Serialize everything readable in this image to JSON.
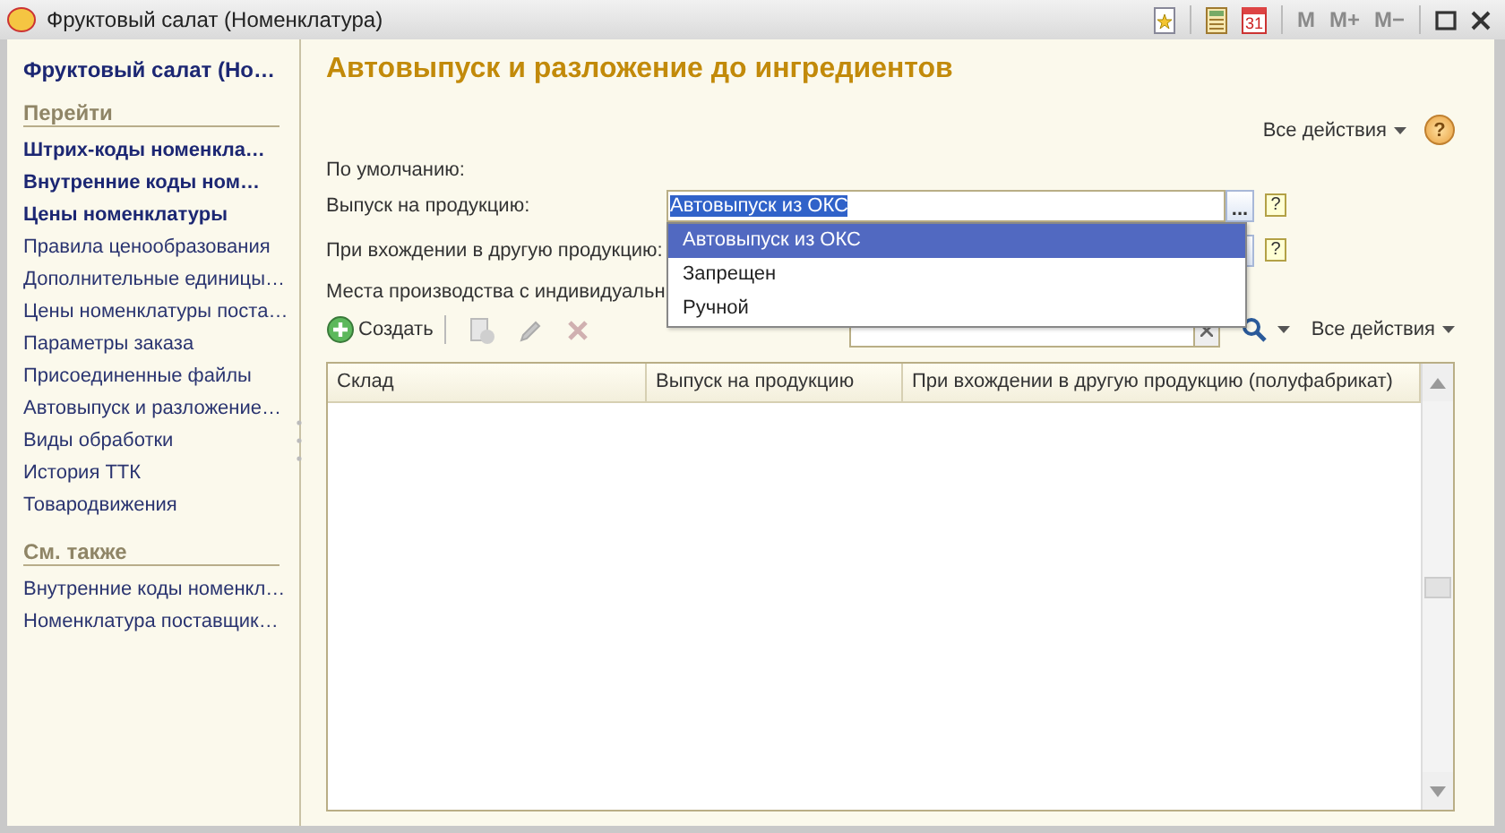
{
  "window": {
    "title": "Фруктовый салат (Номенклатура)",
    "calendar_day": "31",
    "memory_buttons": [
      {
        "label": "M",
        "disabled": true
      },
      {
        "label": "M+",
        "disabled": true
      },
      {
        "label": "M−",
        "disabled": true
      }
    ]
  },
  "sidebar": {
    "title": "Фруктовый салат (Но…",
    "sections": [
      {
        "heading": "Перейти",
        "items": [
          {
            "label": "Штрих-коды номенкла…",
            "bold": true
          },
          {
            "label": "Внутренние коды ном…",
            "bold": true
          },
          {
            "label": "Цены номенклатуры",
            "bold": true
          },
          {
            "label": "Правила ценообразования",
            "bold": false
          },
          {
            "label": "Дополнительные единицы…",
            "bold": false
          },
          {
            "label": "Цены номенклатуры поста…",
            "bold": false
          },
          {
            "label": "Параметры заказа",
            "bold": false
          },
          {
            "label": "Присоединенные файлы",
            "bold": false
          },
          {
            "label": "Автовыпуск и разложение…",
            "bold": false
          },
          {
            "label": "Виды обработки",
            "bold": false
          },
          {
            "label": "История ТТК",
            "bold": false
          },
          {
            "label": "Товародвижения",
            "bold": false
          }
        ]
      },
      {
        "heading": "См. также",
        "items": [
          {
            "label": "Внутренние коды номенкл…",
            "bold": false
          },
          {
            "label": "Номенклатура поставщик…",
            "bold": false
          }
        ]
      }
    ]
  },
  "main": {
    "title": "Автовыпуск и разложение до ингредиентов",
    "all_actions": "Все действия",
    "help": "?",
    "defaults_label": "По умолчанию:",
    "fields": [
      {
        "label": "Выпуск на продукцию:",
        "value": "Автовыпуск из ОКС",
        "highlighted": true,
        "button": "...",
        "hint": "?",
        "dropdown": [
          {
            "label": "Автовыпуск из ОКС",
            "selected": true
          },
          {
            "label": "Запрещен",
            "selected": false
          },
          {
            "label": "Ручной",
            "selected": false
          }
        ]
      },
      {
        "label": "При вхождении в другую продукцию:",
        "hint": "?"
      }
    ],
    "places_label": "Места производства с индивидуальн",
    "toolbar": {
      "create": "Создать",
      "buttons": [
        {
          "kind": "copy",
          "disabled": true
        },
        {
          "kind": "edit",
          "disabled": true
        },
        {
          "kind": "delete",
          "disabled": true
        }
      ],
      "all_actions": "Все действия"
    },
    "table": {
      "columns": [
        "Склад",
        "Выпуск на продукцию",
        "При вхождении в другую продукцию (полуфабрикат)"
      ]
    }
  }
}
